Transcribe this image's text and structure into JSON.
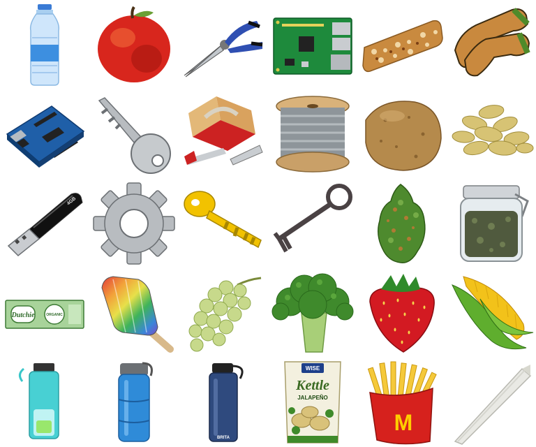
{
  "grid": {
    "rows": 5,
    "columns": 6,
    "items": [
      {
        "icon": "water-bottle-icon"
      },
      {
        "icon": "apple-icon"
      },
      {
        "icon": "pliers-icon"
      },
      {
        "icon": "circuit-board-icon"
      },
      {
        "icon": "granola-bar-icon"
      },
      {
        "icon": "gloves-icon"
      },
      {
        "icon": "arduino-board-icon"
      },
      {
        "icon": "silver-key-icon"
      },
      {
        "icon": "toolbox-icon"
      },
      {
        "icon": "cable-spool-icon"
      },
      {
        "icon": "potato-icon"
      },
      {
        "icon": "pumpkin-seeds-icon"
      },
      {
        "icon": "usb-drive-icon"
      },
      {
        "icon": "gear-icon"
      },
      {
        "icon": "yellow-key-icon"
      },
      {
        "icon": "skeleton-key-icon"
      },
      {
        "icon": "cannabis-bud-icon"
      },
      {
        "icon": "storage-jar-icon"
      },
      {
        "icon": "rolling-papers-icon"
      },
      {
        "icon": "rainbow-popsicle-icon"
      },
      {
        "icon": "grapes-icon"
      },
      {
        "icon": "broccoli-icon"
      },
      {
        "icon": "strawberry-icon"
      },
      {
        "icon": "corn-icon"
      },
      {
        "icon": "infuser-bottle-icon"
      },
      {
        "icon": "blue-water-bottle-icon"
      },
      {
        "icon": "filter-bottle-icon"
      },
      {
        "icon": "chips-bag-icon"
      },
      {
        "icon": "french-fries-icon"
      },
      {
        "icon": "joint-icon"
      }
    ]
  },
  "labels": {
    "usb_text": "4GB",
    "papers_brand": "Dutchie",
    "papers_badge": "ORGANIC",
    "chips_brand": "WISE",
    "chips_name": "Kettle",
    "chips_flavor": "JALAPEÑO",
    "fries_logo": "M",
    "bottle_brand": "BRITA"
  },
  "colors": {
    "background": "#ffffff"
  }
}
